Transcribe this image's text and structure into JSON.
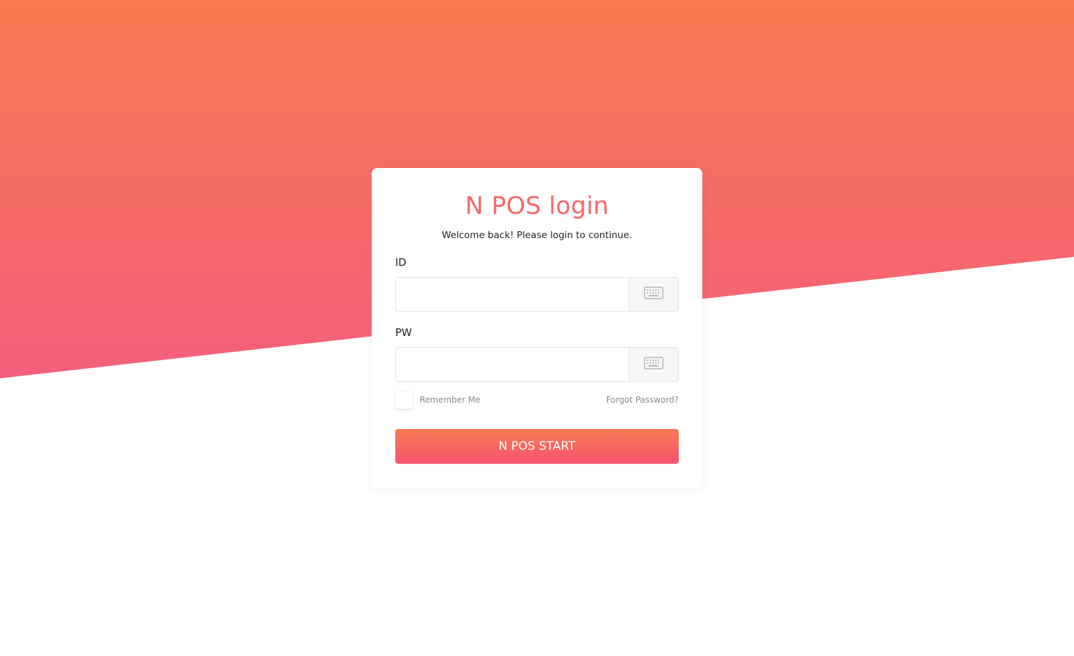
{
  "colors": {
    "gradient_top": "#f97950",
    "gradient_bottom": "#f4607c",
    "title": "#f5676a",
    "button_top": "#f97b53",
    "button_bottom": "#f5536e"
  },
  "login": {
    "title": "N POS login",
    "subtitle": "Welcome back! Please login to continue.",
    "id_label": "ID",
    "id_value": "",
    "id_keyboard_icon": "keyboard-icon",
    "pw_label": "PW",
    "pw_value": "",
    "pw_keyboard_icon": "keyboard-icon",
    "remember_label": "Remember Me",
    "remember_checked": false,
    "forgot_label": "Forgot Password?",
    "start_label": "N POS START"
  }
}
